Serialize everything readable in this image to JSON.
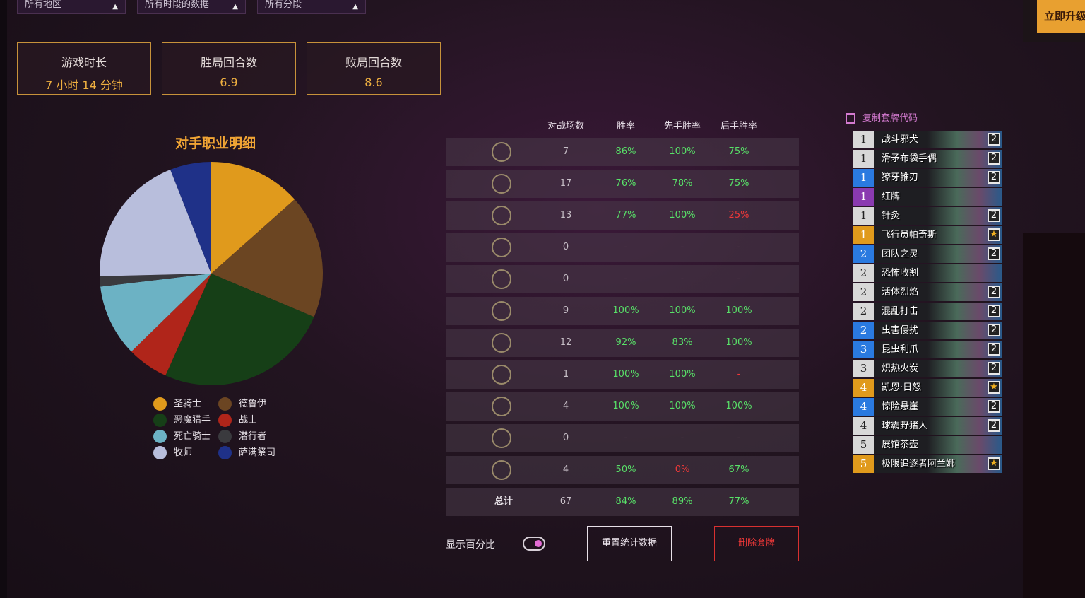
{
  "filters": [
    {
      "label": "所有地区"
    },
    {
      "label": "所有时段的数据"
    },
    {
      "label": "所有分段"
    }
  ],
  "summary": [
    {
      "label": "游戏时长",
      "value": "7 小时 14 分钟"
    },
    {
      "label": "胜局回合数",
      "value": "6.9"
    },
    {
      "label": "败局回合数",
      "value": "8.6"
    }
  ],
  "pie": {
    "title": "对手职业明细",
    "legend": [
      {
        "name": "圣骑士",
        "color": "#e09a1c"
      },
      {
        "name": "德鲁伊",
        "color": "#6b4522"
      },
      {
        "name": "恶魔猎手",
        "color": "#163f17"
      },
      {
        "name": "战士",
        "color": "#b0251a"
      },
      {
        "name": "死亡骑士",
        "color": "#6cb2c4"
      },
      {
        "name": "潜行者",
        "color": "#3a3a3e"
      },
      {
        "name": "牧师",
        "color": "#b8bedc"
      },
      {
        "name": "萨满祭司",
        "color": "#1f3188"
      }
    ]
  },
  "chart_data": {
    "type": "pie",
    "labels": [
      "圣骑士",
      "德鲁伊",
      "恶魔猎手",
      "战士",
      "死亡骑士",
      "潜行者",
      "牧师",
      "萨满祭司"
    ],
    "values": [
      9,
      12,
      17,
      4,
      7,
      1,
      13,
      4
    ]
  },
  "table": {
    "headers": [
      "对战场数",
      "胜率",
      "先手胜率",
      "后手胜率"
    ],
    "rows": [
      {
        "icon": "mage-class-icon",
        "games": "7",
        "wr": "86%",
        "first": "100%",
        "second": "75%",
        "wr_c": "g",
        "first_c": "g",
        "second_c": "g"
      },
      {
        "icon": "demon-hunter-class-icon",
        "games": "17",
        "wr": "76%",
        "first": "78%",
        "second": "75%",
        "wr_c": "g",
        "first_c": "g",
        "second_c": "g"
      },
      {
        "icon": "priest-class-icon",
        "games": "13",
        "wr": "77%",
        "first": "100%",
        "second": "25%",
        "wr_c": "g",
        "first_c": "g",
        "second_c": "r"
      },
      {
        "icon": "rogue-class-icon",
        "games": "0",
        "wr": "-",
        "first": "-",
        "second": "-",
        "wr_c": "dash",
        "first_c": "dash",
        "second_c": "dash"
      },
      {
        "icon": "warlock-class-icon",
        "games": "0",
        "wr": "-",
        "first": "-",
        "second": "-",
        "wr_c": "dash",
        "first_c": "dash",
        "second_c": "dash"
      },
      {
        "icon": "paladin-class-icon",
        "games": "9",
        "wr": "100%",
        "first": "100%",
        "second": "100%",
        "wr_c": "g",
        "first_c": "g",
        "second_c": "g"
      },
      {
        "icon": "druid-class-icon",
        "games": "12",
        "wr": "92%",
        "first": "83%",
        "second": "100%",
        "wr_c": "g",
        "first_c": "g",
        "second_c": "g"
      },
      {
        "icon": "hunter-class-icon",
        "games": "1",
        "wr": "100%",
        "first": "100%",
        "second": "-",
        "wr_c": "g",
        "first_c": "g",
        "second_c": "r"
      },
      {
        "icon": "warrior-class-icon",
        "games": "4",
        "wr": "100%",
        "first": "100%",
        "second": "100%",
        "wr_c": "g",
        "first_c": "g",
        "second_c": "g"
      },
      {
        "icon": "shaman-class-icon",
        "games": "0",
        "wr": "-",
        "first": "-",
        "second": "-",
        "wr_c": "dash",
        "first_c": "dash",
        "second_c": "dash"
      },
      {
        "icon": "death-knight-class-icon",
        "games": "4",
        "wr": "50%",
        "first": "0%",
        "second": "67%",
        "wr_c": "g",
        "first_c": "r",
        "second_c": "g"
      }
    ],
    "total": {
      "label": "总计",
      "games": "67",
      "wr": "84%",
      "first": "89%",
      "second": "77%"
    }
  },
  "controls": {
    "toggle_label": "显示百分比",
    "reset_label": "重置统计数据",
    "delete_label": "删除套牌"
  },
  "deck": {
    "copy_label": "复制套牌代码",
    "cards": [
      {
        "cost": "1",
        "name": "战斗邪犬",
        "qty": "2",
        "rarity": "#d8d8d8"
      },
      {
        "cost": "1",
        "name": "滑矛布袋手偶",
        "qty": "2",
        "rarity": "#d8d8d8"
      },
      {
        "cost": "1",
        "name": "獠牙锥刃",
        "qty": "2",
        "rarity": "#2a7ae0"
      },
      {
        "cost": "1",
        "name": "红牌",
        "qty": "",
        "rarity": "#8a3ab0"
      },
      {
        "cost": "1",
        "name": "针灸",
        "qty": "2",
        "rarity": "#d8d8d8"
      },
      {
        "cost": "1",
        "name": "飞行员帕奇斯",
        "qty": "★",
        "rarity": "#e09a1c"
      },
      {
        "cost": "2",
        "name": "团队之灵",
        "qty": "2",
        "rarity": "#2a7ae0"
      },
      {
        "cost": "2",
        "name": "恐怖收割",
        "qty": "",
        "rarity": "#d8d8d8"
      },
      {
        "cost": "2",
        "name": "活体烈焰",
        "qty": "2",
        "rarity": "#d8d8d8"
      },
      {
        "cost": "2",
        "name": "混乱打击",
        "qty": "2",
        "rarity": "#d8d8d8"
      },
      {
        "cost": "2",
        "name": "虫害侵扰",
        "qty": "2",
        "rarity": "#2a7ae0"
      },
      {
        "cost": "3",
        "name": "昆虫利爪",
        "qty": "2",
        "rarity": "#2a7ae0"
      },
      {
        "cost": "3",
        "name": "炽热火炭",
        "qty": "2",
        "rarity": "#d8d8d8"
      },
      {
        "cost": "4",
        "name": "凯恩·日怒",
        "qty": "★",
        "rarity": "#e09a1c"
      },
      {
        "cost": "4",
        "name": "惊险悬崖",
        "qty": "2",
        "rarity": "#2a7ae0"
      },
      {
        "cost": "4",
        "name": "球霸野猪人",
        "qty": "2",
        "rarity": "#d8d8d8"
      },
      {
        "cost": "5",
        "name": "展馆茶壶",
        "qty": "",
        "rarity": "#d8d8d8"
      },
      {
        "cost": "5",
        "name": "极限追逐者阿兰娜",
        "qty": "★",
        "rarity": "#e09a1c"
      }
    ]
  },
  "upgrade_label": "立即升级"
}
